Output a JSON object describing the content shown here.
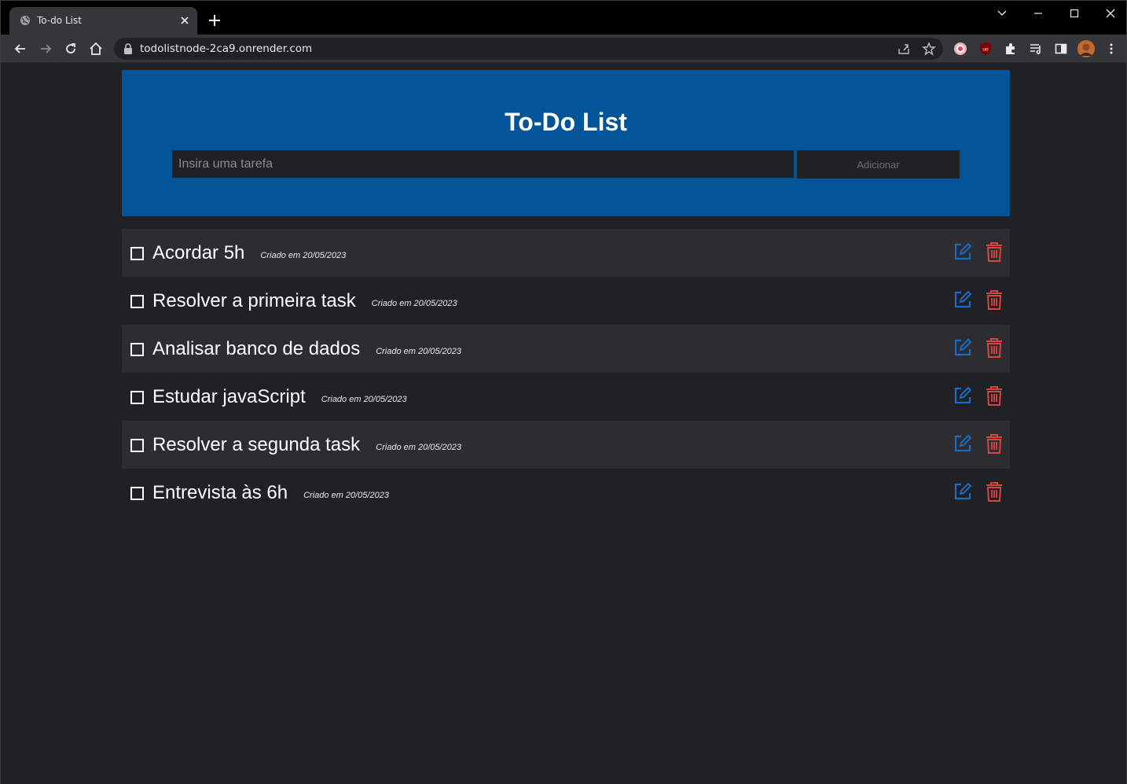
{
  "browser": {
    "tab_title": "To-do List",
    "url": "todolistnode-2ca9.onrender.com"
  },
  "app": {
    "title": "To-Do List",
    "input_placeholder": "Insira uma tarefa",
    "add_button": "Adicionar",
    "colors": {
      "header": "#005497",
      "edit": "#1b6bc4",
      "delete": "#d9443f"
    }
  },
  "tasks": [
    {
      "name": "Acordar 5h",
      "created": "Criado em 20/05/2023"
    },
    {
      "name": "Resolver a primeira task",
      "created": "Criado em 20/05/2023"
    },
    {
      "name": "Analisar banco de dados",
      "created": "Criado em 20/05/2023"
    },
    {
      "name": "Estudar javaScript",
      "created": "Criado em 20/05/2023"
    },
    {
      "name": "Resolver a segunda task",
      "created": "Criado em 20/05/2023"
    },
    {
      "name": "Entrevista às 6h",
      "created": "Criado em 20/05/2023"
    }
  ]
}
